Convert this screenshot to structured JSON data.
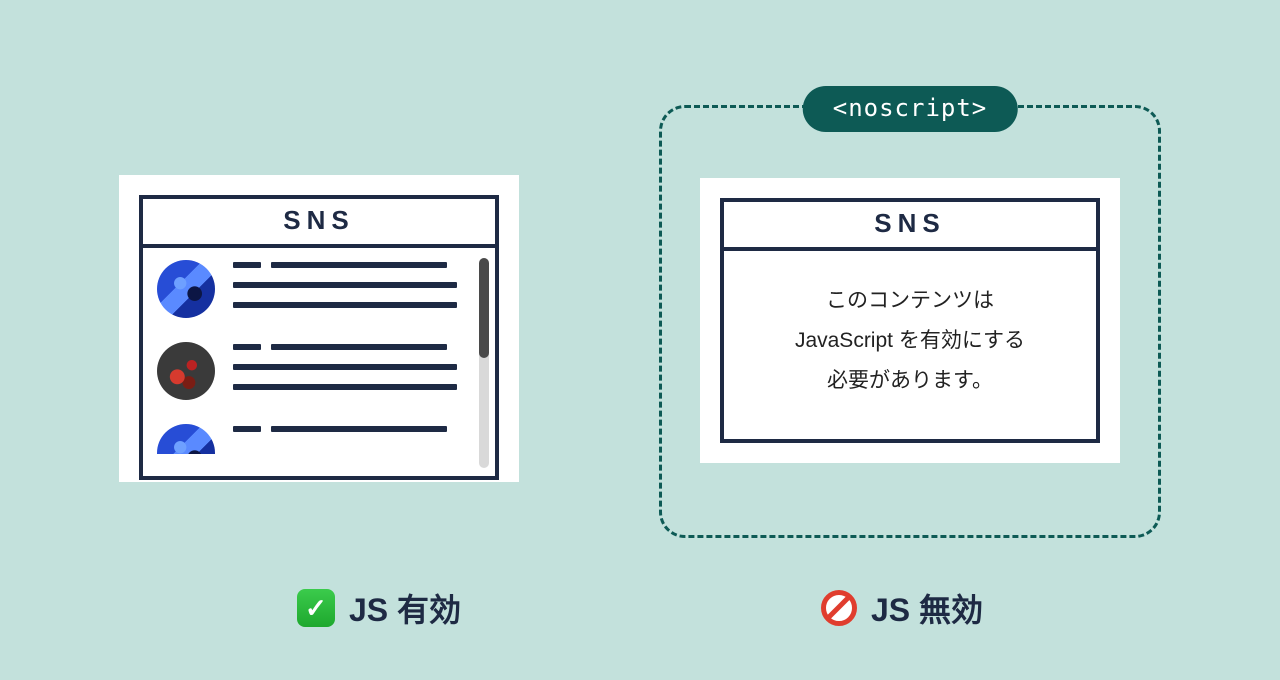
{
  "noscript_tag": "<noscript>",
  "left": {
    "title": "SNS",
    "feed_lines_placeholder": true
  },
  "right": {
    "title": "SNS",
    "message_line1": "このコンテンツは",
    "message_line2": "JavaScript を有効にする",
    "message_line3": "必要があります。"
  },
  "captions": {
    "left": "JS 有効",
    "right": "JS 無効"
  }
}
